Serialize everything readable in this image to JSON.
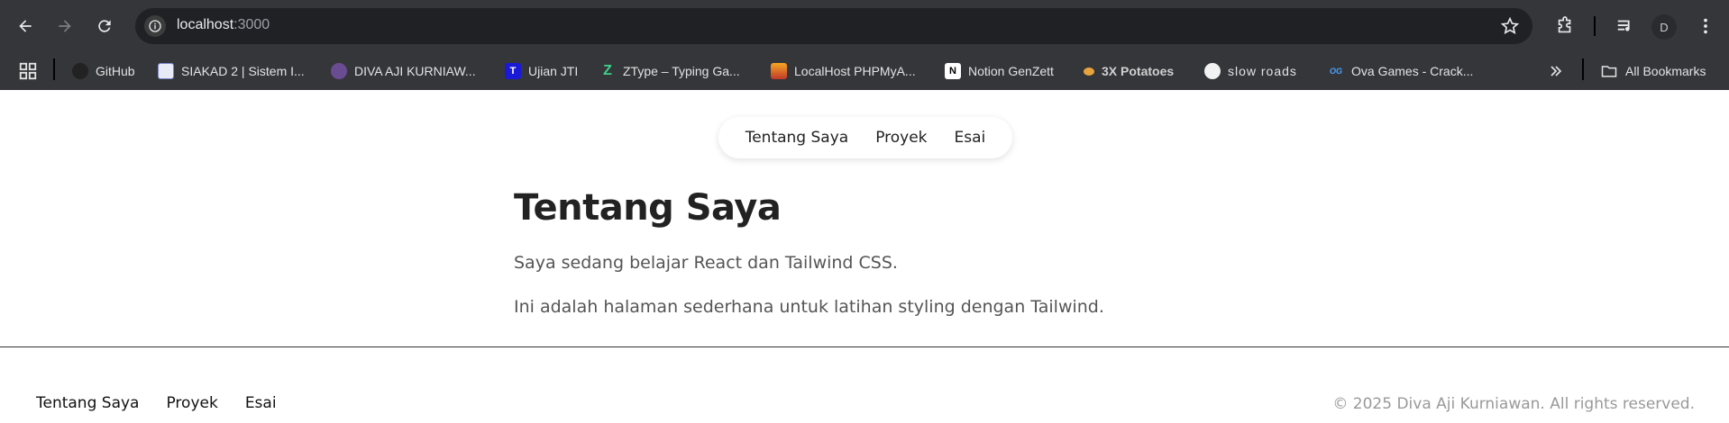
{
  "browser": {
    "url_host": "localhost",
    "url_port": ":3000",
    "profile_initial": "D",
    "bookmarks": [
      {
        "label": "GitHub",
        "icon": "github-icon"
      },
      {
        "label": "SIAKAD 2 | Sistem I...",
        "icon": "siakad-icon"
      },
      {
        "label": "DIVA AJI KURNIAW...",
        "icon": "university-icon"
      },
      {
        "label": "Ujian JTI",
        "icon": "jti-icon"
      },
      {
        "label": "ZType – Typing Ga...",
        "icon": "ztype-icon"
      },
      {
        "label": "LocalHost PHPMyA...",
        "icon": "phpmyadmin-icon"
      },
      {
        "label": "Notion GenZett",
        "icon": "notion-icon"
      },
      {
        "label": "3X Potatoes",
        "icon": "potato-icon"
      },
      {
        "label": "slow roads",
        "icon": "slowroads-icon"
      },
      {
        "label": "Ova Games - Crack...",
        "icon": "ovagames-icon"
      }
    ],
    "all_bookmarks_label": "All Bookmarks"
  },
  "page": {
    "nav": [
      "Tentang Saya",
      "Proyek",
      "Esai"
    ],
    "heading": "Tentang Saya",
    "paragraph1": "Saya sedang belajar React dan Tailwind CSS.",
    "paragraph2": "Ini adalah halaman sederhana untuk latihan styling dengan Tailwind.",
    "footer_nav": [
      "Tentang Saya",
      "Proyek",
      "Esai"
    ],
    "copyright": "© 2025 Diva Aji Kurniawan. All rights reserved."
  }
}
